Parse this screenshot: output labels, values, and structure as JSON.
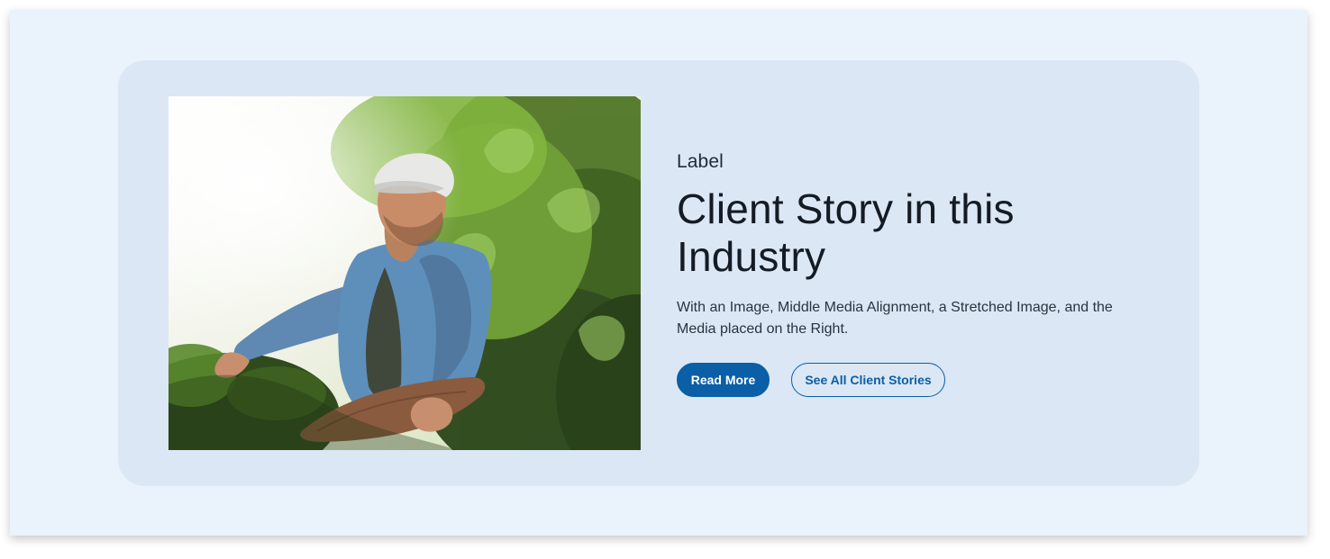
{
  "section": {
    "label": "Label",
    "title": "Client Story in this Industry",
    "description": "With an Image, Middle Media Alignment, a Stretched Image, and the Media placed on the Right.",
    "buttons": {
      "primary": "Read More",
      "secondary": "See All Client Stories"
    },
    "image": {
      "semantic": "farmer-with-clipboard-photo"
    }
  },
  "colors": {
    "page_bg": "#eaf2fb",
    "card_bg": "#dbe7f4",
    "accent": "#0b5fa6",
    "text": "#141b24"
  }
}
